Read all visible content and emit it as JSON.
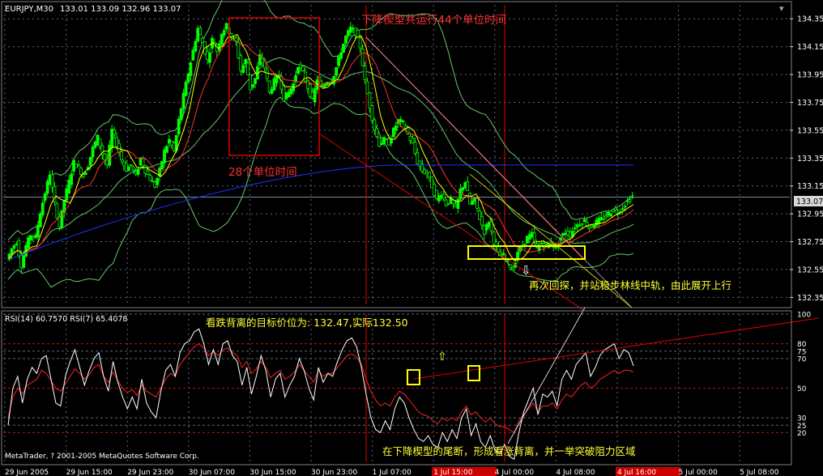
{
  "chart_data": [
    {
      "type": "candlestick",
      "title": "EURJPY,M30",
      "header_values": "133.01 133.09 132.96 133.07",
      "current_price": "133.07",
      "y_ticks": [
        "134.35",
        "134.15",
        "133.95",
        "133.75",
        "133.55",
        "133.35",
        "133.15",
        "132.95",
        "132.75",
        "132.55",
        "132.35"
      ],
      "ylim": [
        132.3,
        134.45
      ],
      "x_ticks": [
        "29 Jun 2005",
        "29 Jun 15:00",
        "29 Jun 23:00",
        "30 Jun 07:00",
        "30 Jun 15:00",
        "30 Jun 23:00",
        "1 Jul 07:00",
        "1 Jul 15:00",
        "4 Jul 00:00",
        "4 Jul 08:00",
        "4 Jul 16:00",
        "5 Jul 00:00",
        "5 Jul 08:00"
      ],
      "highlighted_x_ticks": [
        7,
        10
      ],
      "price_path": [
        132.62,
        132.7,
        132.75,
        132.58,
        132.72,
        132.8,
        132.78,
        132.96,
        133.1,
        133.24,
        133.02,
        132.86,
        133.05,
        133.18,
        133.32,
        133.28,
        133.22,
        133.3,
        133.42,
        133.5,
        133.38,
        133.3,
        133.55,
        133.45,
        133.34,
        133.27,
        133.3,
        133.22,
        133.35,
        133.26,
        133.2,
        133.15,
        133.26,
        133.4,
        133.48,
        133.4,
        133.62,
        133.8,
        133.96,
        134.12,
        134.28,
        134.18,
        134.05,
        134.2,
        134.12,
        134.25,
        134.3,
        134.22,
        134.18,
        133.98,
        134.05,
        133.85,
        133.92,
        134.08,
        134.0,
        133.82,
        133.9,
        133.95,
        133.78,
        133.82,
        133.88,
        134.02,
        133.96,
        133.86,
        133.76,
        133.92,
        133.86,
        133.9,
        133.9,
        134.0,
        134.12,
        134.22,
        134.28,
        134.25,
        134.15,
        133.9,
        133.72,
        133.56,
        133.45,
        133.48,
        133.46,
        133.55,
        133.62,
        133.6,
        133.52,
        133.45,
        133.32,
        133.26,
        133.24,
        133.15,
        133.05,
        133.1,
        133.02,
        133.05,
        132.98,
        133.12,
        133.18,
        133.02,
        133.05,
        132.92,
        132.82,
        132.9,
        132.75,
        132.66,
        132.65,
        132.6,
        132.55,
        132.68,
        132.72,
        132.78,
        132.8,
        132.7,
        132.74,
        132.72,
        132.74,
        132.7,
        132.78,
        132.82,
        132.8,
        132.86,
        132.88,
        132.9,
        132.85,
        132.88,
        132.9,
        132.92,
        132.95,
        132.98,
        132.96,
        133.0,
        133.04,
        133.07
      ],
      "indicators": {
        "ma_slow_start": 132.62,
        "ma_slow_end": 133.3,
        "ma_slow_peak_x_fraction": 0.62
      },
      "annotations": [
        "下降楔型共运行44个单位时间",
        "28个单位时间",
        "再次回探，并站稳步林线中轨，由此展开上行"
      ],
      "annotation_accents": {
        "44": "44",
        "28": "28"
      }
    },
    {
      "type": "line",
      "title": "RSI(14) 60.7570  RSI(7) 65.4078",
      "y_ticks": [
        "100",
        "80",
        "75",
        "70",
        "50",
        "30",
        "25",
        "20"
      ],
      "ylim": [
        0,
        100
      ],
      "series": [
        {
          "name": "RSI(14)",
          "color": "#ff2020",
          "values": [
            30,
            44,
            50,
            46,
            52,
            54,
            56,
            62,
            60,
            55,
            50,
            48,
            53,
            58,
            63,
            60,
            56,
            59,
            64,
            66,
            58,
            54,
            61,
            55,
            50,
            47,
            49,
            45,
            52,
            48,
            46,
            44,
            50,
            56,
            60,
            58,
            66,
            70,
            74,
            78,
            80,
            77,
            72,
            75,
            72,
            76,
            77,
            74,
            72,
            64,
            68,
            60,
            63,
            68,
            64,
            57,
            60,
            62,
            56,
            58,
            61,
            66,
            62,
            58,
            54,
            62,
            58,
            60,
            60,
            64,
            68,
            72,
            73,
            71,
            66,
            56,
            48,
            42,
            38,
            40,
            38,
            44,
            48,
            46,
            42,
            38,
            34,
            32,
            31,
            28,
            26,
            30,
            28,
            30,
            28,
            34,
            38,
            32,
            34,
            30,
            27,
            30,
            26,
            24,
            24,
            22,
            20,
            28,
            32,
            36,
            40,
            34,
            38,
            38,
            40,
            36,
            42,
            46,
            44,
            48,
            52,
            54,
            50,
            52,
            56,
            58,
            60,
            62,
            60,
            62,
            62,
            61
          ]
        },
        {
          "name": "RSI(7)",
          "color": "#ffffff",
          "values": [
            25,
            50,
            58,
            40,
            56,
            64,
            60,
            70,
            72,
            56,
            40,
            38,
            58,
            68,
            76,
            64,
            52,
            62,
            70,
            74,
            58,
            48,
            68,
            54,
            44,
            36,
            44,
            36,
            56,
            40,
            34,
            30,
            48,
            62,
            66,
            58,
            74,
            80,
            82,
            88,
            90,
            80,
            66,
            76,
            66,
            80,
            82,
            72,
            68,
            52,
            64,
            46,
            58,
            72,
            62,
            44,
            56,
            60,
            44,
            52,
            58,
            70,
            62,
            50,
            42,
            64,
            54,
            60,
            58,
            68,
            76,
            82,
            84,
            78,
            64,
            46,
            30,
            22,
            20,
            28,
            22,
            36,
            44,
            40,
            30,
            22,
            16,
            14,
            18,
            12,
            10,
            20,
            14,
            22,
            16,
            30,
            36,
            18,
            26,
            14,
            10,
            18,
            8,
            6,
            12,
            4,
            2,
            20,
            34,
            42,
            50,
            32,
            46,
            44,
            48,
            38,
            56,
            62,
            56,
            66,
            70,
            74,
            58,
            64,
            72,
            76,
            78,
            80,
            70,
            76,
            74,
            65
          ]
        }
      ],
      "annotations": [
        "看跌背离的目标价位为:  132.47,实际132.50",
        "在下降楔型的尾断，形成看涨背离，并一举突破阻力区域"
      ],
      "arrow_glyph": "⇧",
      "copyright": "MetaTrader, ? 2001-2005 MetaQuotes Software Corp."
    }
  ],
  "colors": {
    "bull": "#00ff00",
    "grid": "#5a6a78",
    "axis_text": "#ffffff",
    "bollinger": "#64c864",
    "ma_fast": "#ffff00",
    "ma_mid": "#ff3030",
    "ma_slow": "#2030ff",
    "red_line": "#e00000",
    "yellow_box": "#ffff00",
    "annotation_red": "#ff3030",
    "annotation_yellow": "#ffff33"
  },
  "down_arrow_glyph": "⇩"
}
